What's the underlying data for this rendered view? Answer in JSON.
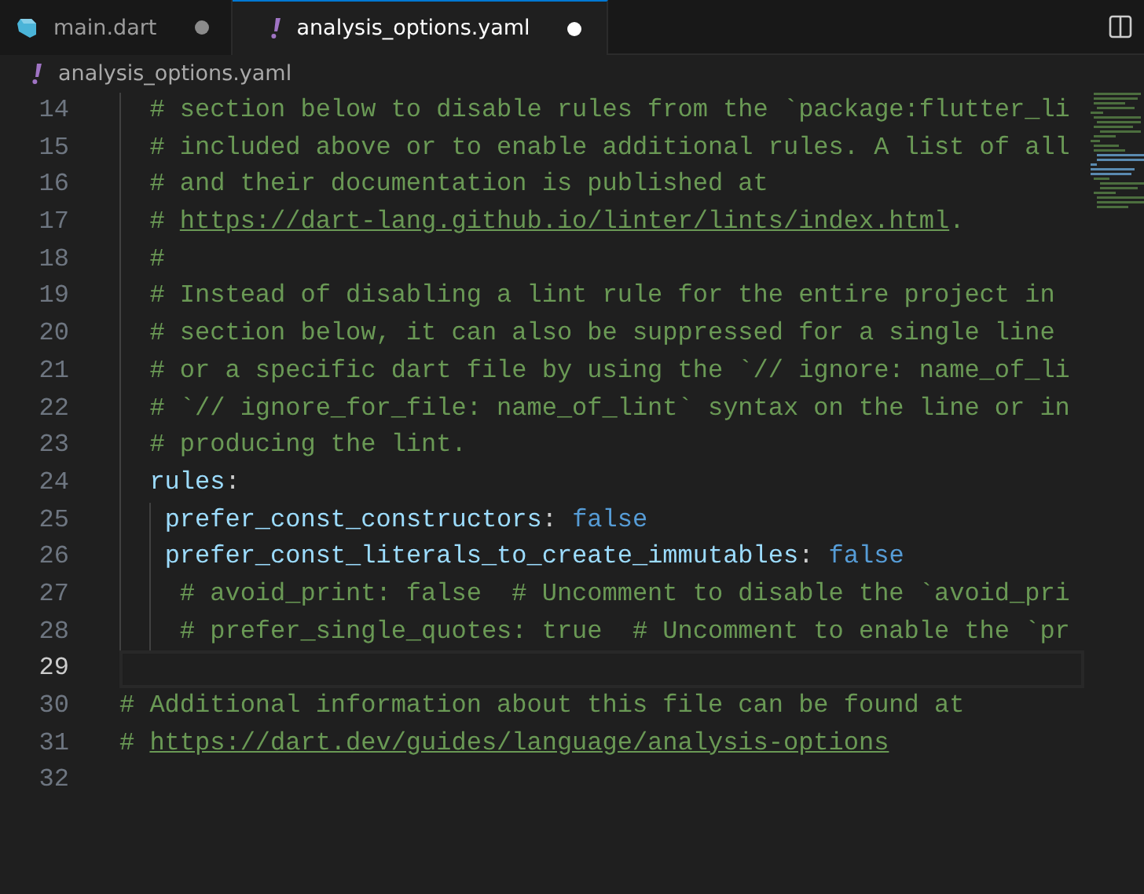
{
  "tabs": [
    {
      "label": "main.dart",
      "kind": "dart",
      "selected": false,
      "modified": true
    },
    {
      "label": "analysis_options.yaml",
      "kind": "yaml",
      "selected": true,
      "modified": true
    }
  ],
  "breadcrumb": {
    "kind": "yaml",
    "label": "analysis_options.yaml"
  },
  "lines": [
    {
      "number": "14",
      "current": false,
      "tokens": [
        {
          "kind": "comment",
          "text": "  # section below to disable rules from the `package:flutter_li"
        }
      ]
    },
    {
      "number": "15",
      "current": false,
      "tokens": [
        {
          "kind": "comment",
          "text": "  # included above or to enable additional rules. A list of all"
        }
      ]
    },
    {
      "number": "16",
      "current": false,
      "tokens": [
        {
          "kind": "comment",
          "text": "  # and their documentation is published at"
        }
      ]
    },
    {
      "number": "17",
      "current": false,
      "tokens": [
        {
          "kind": "comment",
          "text": "  # "
        },
        {
          "kind": "link",
          "text": "https://dart-lang.github.io/linter/lints/index.html"
        },
        {
          "kind": "comment",
          "text": "."
        }
      ]
    },
    {
      "number": "18",
      "current": false,
      "tokens": [
        {
          "kind": "comment",
          "text": "  #"
        }
      ]
    },
    {
      "number": "19",
      "current": false,
      "tokens": [
        {
          "kind": "comment",
          "text": "  # Instead of disabling a lint rule for the entire project in"
        }
      ]
    },
    {
      "number": "20",
      "current": false,
      "tokens": [
        {
          "kind": "comment",
          "text": "  # section below, it can also be suppressed for a single line"
        }
      ]
    },
    {
      "number": "21",
      "current": false,
      "tokens": [
        {
          "kind": "comment",
          "text": "  # or a specific dart file by using the `// ignore: name_of_li"
        }
      ]
    },
    {
      "number": "22",
      "current": false,
      "tokens": [
        {
          "kind": "comment",
          "text": "  # `// ignore_for_file: name_of_lint` syntax on the line or in"
        }
      ]
    },
    {
      "number": "23",
      "current": false,
      "tokens": [
        {
          "kind": "comment",
          "text": "  # producing the lint."
        }
      ]
    },
    {
      "number": "24",
      "current": false,
      "tokens": [
        {
          "kind": "key",
          "text": "  rules"
        },
        {
          "kind": "punct",
          "text": ":"
        }
      ]
    },
    {
      "number": "25",
      "current": false,
      "tokens": [
        {
          "kind": "key",
          "text": "   prefer_const_constructors"
        },
        {
          "kind": "punct",
          "text": ":"
        },
        {
          "kind": "bool",
          "text": "false"
        }
      ]
    },
    {
      "number": "26",
      "current": false,
      "tokens": [
        {
          "kind": "key",
          "text": "   prefer_const_literals_to_create_immutables"
        },
        {
          "kind": "punct",
          "text": ":"
        },
        {
          "kind": "bool",
          "text": "false"
        }
      ]
    },
    {
      "number": "27",
      "current": false,
      "tokens": [
        {
          "kind": "comment",
          "text": "    # avoid_print: false  # Uncomment to disable the `avoid_pri"
        }
      ]
    },
    {
      "number": "28",
      "current": false,
      "tokens": [
        {
          "kind": "comment",
          "text": "    # prefer_single_quotes: true  # Uncomment to enable the `pr"
        }
      ]
    },
    {
      "number": "29",
      "current": true
    },
    {
      "number": "30",
      "current": false,
      "tokens": [
        {
          "kind": "comment",
          "text": "# Additional information about this file can be found at"
        }
      ]
    },
    {
      "number": "31",
      "current": false,
      "tokens": [
        {
          "kind": "comment",
          "text": "# "
        },
        {
          "kind": "link",
          "text": "https://dart.dev/guides/language/analysis-options"
        }
      ]
    },
    {
      "number": "32",
      "current": false
    }
  ]
}
